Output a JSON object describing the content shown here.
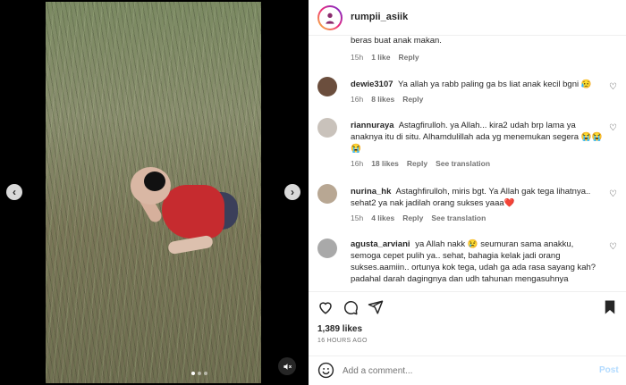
{
  "header": {
    "username": "rumpii_asiik"
  },
  "comments": [
    {
      "username": "",
      "text": "beras buat anak makan.",
      "time": "15h",
      "likes": "1 like",
      "reply": "Reply",
      "translate": ""
    },
    {
      "username": "dewie3107",
      "text": "Ya allah ya rabb paling ga bs liat anak kecil bgni 😥",
      "time": "16h",
      "likes": "8 likes",
      "reply": "Reply",
      "translate": ""
    },
    {
      "username": "riannuraya",
      "text": "Astagfirulloh. ya Allah... kira2 udah brp lama ya anaknya itu di situ. Alhamdulillah ada yg menemukan segera 😭😭😭",
      "time": "16h",
      "likes": "18 likes",
      "reply": "Reply",
      "translate": "See translation"
    },
    {
      "username": "nurina_hk",
      "text": "Astaghfirulloh, miris bgt. Ya Allah gak tega lihatnya.. sehat2 ya nak jadilah orang sukses yaaa❤️",
      "time": "15h",
      "likes": "4 likes",
      "reply": "Reply",
      "translate": "See translation"
    },
    {
      "username": "agusta_arviani",
      "text": "ya Allah nakk 😢 seumuran sama anakku, semoga cepet pulih ya.. sehat, bahagia kelak jadi orang sukses.aamiin.. ortunya kok tega, udah ga ada rasa sayang kah? padahal darah dagingnya dan udh tahunan mengasuhnya",
      "time": "",
      "likes": "",
      "reply": "",
      "translate": ""
    }
  ],
  "post": {
    "likes": "1,389 likes",
    "time_ago": "16 HOURS AGO"
  },
  "compose": {
    "placeholder": "Add a comment...",
    "post_label": "Post"
  },
  "colors": {
    "accent_link": "#b3dbff",
    "muted": "#737373",
    "heart_red": "#ed4956"
  },
  "icons": [
    "chevron-left-icon",
    "chevron-right-icon",
    "mute-icon",
    "heart-icon",
    "comment-icon",
    "share-icon",
    "bookmark-icon",
    "emoji-icon"
  ]
}
